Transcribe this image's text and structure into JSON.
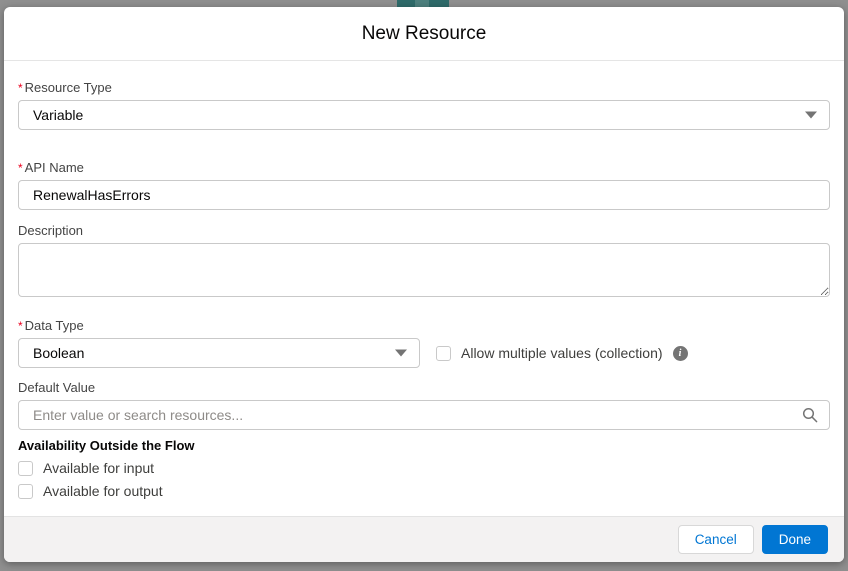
{
  "dialog": {
    "title": "New Resource",
    "required_marker": "*"
  },
  "fields": {
    "resource_type": {
      "label": "Resource Type",
      "required": true,
      "value": "Variable"
    },
    "api_name": {
      "label": "API Name",
      "required": true,
      "value": "RenewalHasErrors"
    },
    "description": {
      "label": "Description",
      "value": ""
    },
    "data_type": {
      "label": "Data Type",
      "required": true,
      "value": "Boolean"
    },
    "collection_checkbox": {
      "label": "Allow multiple values (collection)",
      "checked": false,
      "info_icon_glyph": "i"
    },
    "default_value": {
      "label": "Default Value",
      "value": "",
      "placeholder": "Enter value or search resources..."
    }
  },
  "availability": {
    "heading": "Availability Outside the Flow",
    "options": [
      {
        "label": "Available for input",
        "checked": false
      },
      {
        "label": "Available for output",
        "checked": false
      }
    ]
  },
  "footer": {
    "cancel_label": "Cancel",
    "done_label": "Done"
  },
  "colors": {
    "brand": "#0176d3",
    "required": "#ea001e",
    "overlay_background": "#8f8f8f",
    "footer_background": "#f3f2f2",
    "input_border": "#c9c9c9",
    "canvas_artifact_teal": "#2f6b6a"
  }
}
